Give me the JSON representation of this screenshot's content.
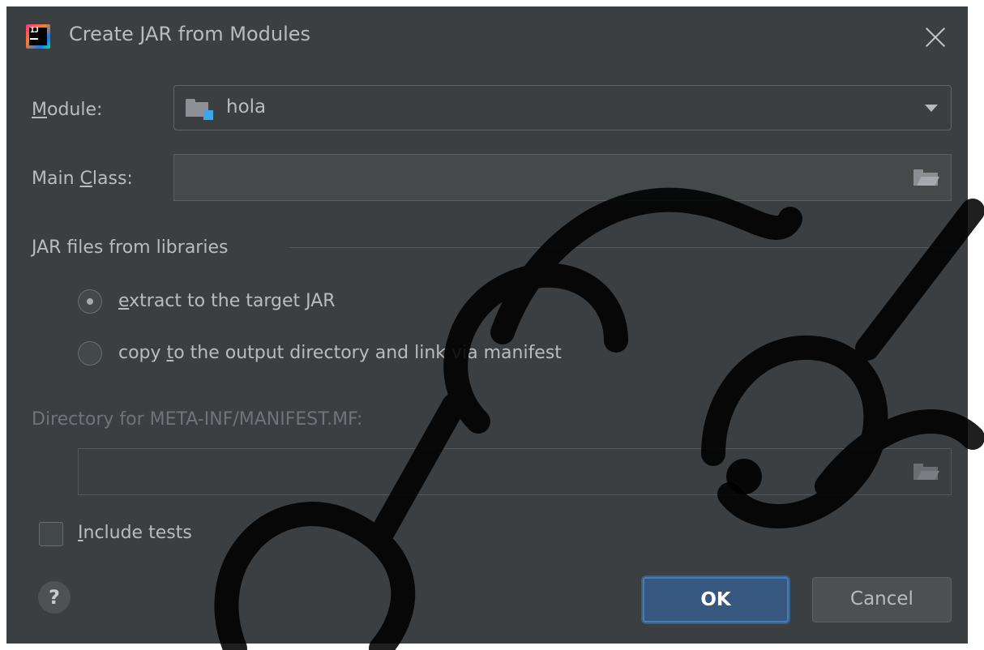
{
  "window": {
    "title": "Create JAR from Modules",
    "app_icon": "intellij-idea-icon",
    "app_icon_text": "IJ"
  },
  "module": {
    "label": "Module:",
    "value": "hola",
    "icon": "module-folder-icon"
  },
  "main_class": {
    "label": "Main Class:",
    "value": ""
  },
  "libraries": {
    "section_label": "JAR files from libraries",
    "options": [
      {
        "label": "extract to the target JAR",
        "selected": true
      },
      {
        "label": "copy to the output directory and link via manifest",
        "selected": false
      }
    ]
  },
  "manifest": {
    "label": "Directory for META-INF/MANIFEST.MF:",
    "value": "",
    "enabled": false
  },
  "include_tests": {
    "label": "Include tests",
    "checked": false
  },
  "buttons": {
    "help": "?",
    "ok": "OK",
    "cancel": "Cancel"
  },
  "colors": {
    "dialog_bg": "#3c3f41",
    "text": "#bbbbbb",
    "ok_button": "#365880",
    "accent_blue": "#3ea7e8"
  }
}
